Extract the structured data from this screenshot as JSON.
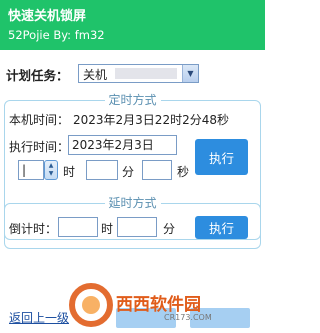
{
  "header": {
    "title": "快速关机锁屏",
    "subtitle": "52Pojie By:  fm32"
  },
  "task": {
    "label": "计划任务：",
    "selected": "关机"
  },
  "timer_group": {
    "legend": "定时方式",
    "local_time_label": "本机时间：",
    "local_time_value": "2023年2月3日22时2分48秒",
    "exec_time_label": "执行时间：",
    "exec_date_value": "2023年2月3日",
    "hour_value": "|",
    "hour_unit": "时",
    "minute_unit": "分",
    "second_unit": "秒",
    "execute_button": "执行"
  },
  "delay_group": {
    "legend": "延时方式",
    "countdown_label": "倒计时：",
    "hour_unit": "时",
    "minute_unit": "分",
    "execute_button": "执行"
  },
  "footer": {
    "back_link": "返回上一级"
  },
  "watermark": {
    "text": "西西软件园",
    "sub": "CR173.COM"
  },
  "colors": {
    "header_bg": "#1fc36a",
    "button_bg": "#2d8ddf",
    "group_border": "#a9d6ec",
    "legend_text": "#5a8fb0",
    "watermark": "#e05c1a"
  }
}
